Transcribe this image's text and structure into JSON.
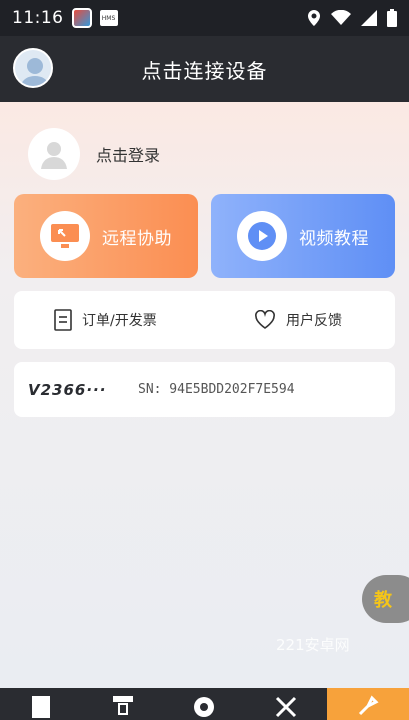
{
  "status_bar": {
    "time": "11:16",
    "app_badge_text": "HMS"
  },
  "header": {
    "title": "点击连接设备"
  },
  "login": {
    "label": "点击登录"
  },
  "cards": {
    "remote_assist": "远程协助",
    "video_tutorial": "视频教程"
  },
  "links": {
    "orders": "订单/开发票",
    "feedback": "用户反馈"
  },
  "device": {
    "name": "V2366···",
    "sn": "SN:  94E5BDD202F7E594"
  },
  "float_button": {
    "label": "教"
  },
  "watermark": "221安卓网",
  "colors": {
    "accent_orange": "#fb8e52",
    "accent_blue": "#5f8ff5",
    "header_bg": "#2a2c31",
    "nav_active": "#f7a23b"
  }
}
